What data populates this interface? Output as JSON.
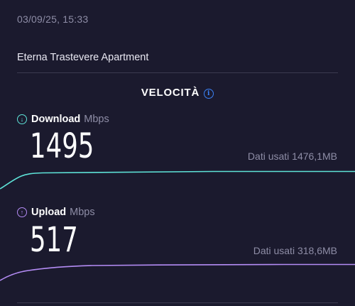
{
  "timestamp": "03/09/25, 15:33",
  "location": "Eterna Trastevere Apartment",
  "section": {
    "title": "VELOCITÀ",
    "info_icon": "info-icon"
  },
  "download": {
    "label": "Download",
    "unit": "Mbps",
    "value": "1495",
    "data_used": "Dati usati 1476,1MB",
    "color": "#5ee3d8",
    "icon": "arrow-down-circle-icon"
  },
  "upload": {
    "label": "Upload",
    "unit": "Mbps",
    "value": "517",
    "data_used": "Dati usati 318,6MB",
    "color": "#b48cf5",
    "icon": "arrow-up-circle-icon"
  },
  "colors": {
    "background": "#1b1a2e",
    "muted_text": "#8e8da6",
    "accent_info": "#3b82f6"
  }
}
